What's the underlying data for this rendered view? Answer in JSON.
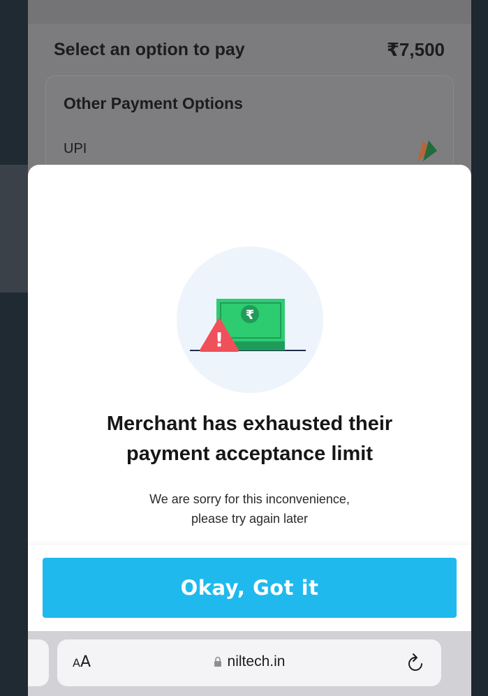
{
  "payment": {
    "heading": "Select an option to pay",
    "amount": "₹7,500",
    "options_title": "Other Payment Options",
    "upi_label": "UPI",
    "upi_icon": "upi-logo-icon"
  },
  "modal": {
    "heading_line1": "Merchant has exhausted their",
    "heading_line2": "payment acceptance limit",
    "sub_line1": "We are sorry for this inconvenience,",
    "sub_line2": "please try again later",
    "button_label": "Okay, Got it",
    "illustration_icon": "cash-warning-icon",
    "rupee_symbol": "₹",
    "warning_symbol": "!"
  },
  "browser": {
    "aa_small": "A",
    "aa_big": "A",
    "url": "niltech.in",
    "lock_icon": "lock-icon",
    "reload_icon": "reload-icon"
  },
  "colors": {
    "accent_button": "#1fb9ee",
    "warning": "#f0505a",
    "cash_green": "#2ecc71"
  }
}
